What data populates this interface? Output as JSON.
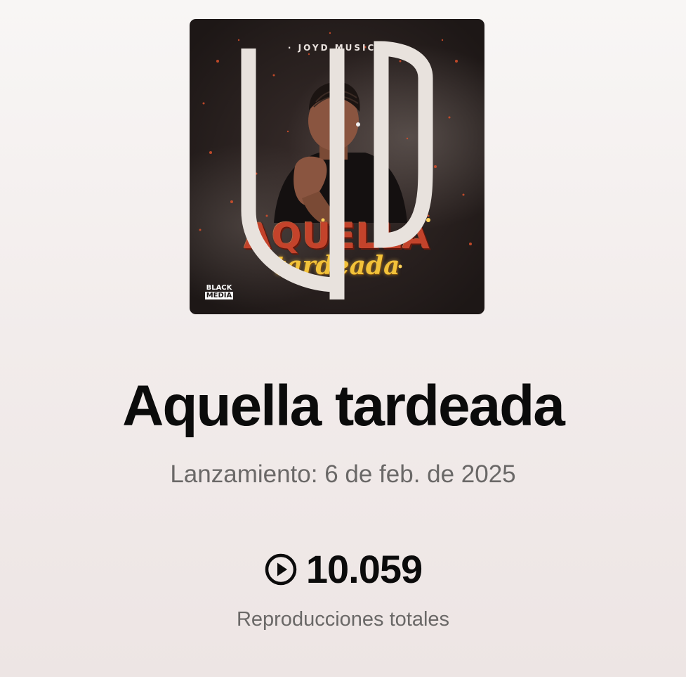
{
  "album": {
    "cover": {
      "label_text": "· JOYD MUSIC ·",
      "title_text": "AQUELLA",
      "subtitle_text": "tardeada",
      "logo_left_line1": "BLACK",
      "logo_left_line2": "MEDIA",
      "colors": {
        "background": "#1d1716",
        "ember": "#c4432b",
        "gold": "#f2c23a"
      }
    }
  },
  "track": {
    "title": "Aquella tardeada",
    "release": "Lanzamiento: 6 de feb. de 2025"
  },
  "stats": {
    "play_icon": "play-circle-icon",
    "plays_count": "10.059",
    "plays_label": "Reproducciones totales"
  }
}
